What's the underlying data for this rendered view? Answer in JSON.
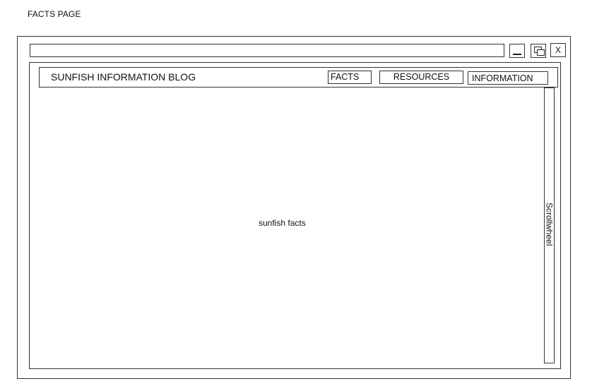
{
  "page": {
    "caption": "FACTS PAGE"
  },
  "window": {
    "address_bar_value": "",
    "controls": {
      "minimize_icon": "minimize-icon",
      "restore_icon": "restore-icon",
      "close_label": "X"
    }
  },
  "nav": {
    "site_title": "SUNFISH INFORMATION BLOG",
    "tabs": [
      {
        "label": "FACTS"
      },
      {
        "label": "RESOURCES"
      },
      {
        "label": "INFORMATION"
      }
    ]
  },
  "main": {
    "content_text": "sunfish facts"
  },
  "scrollbar": {
    "label": "Scrollwheel"
  }
}
